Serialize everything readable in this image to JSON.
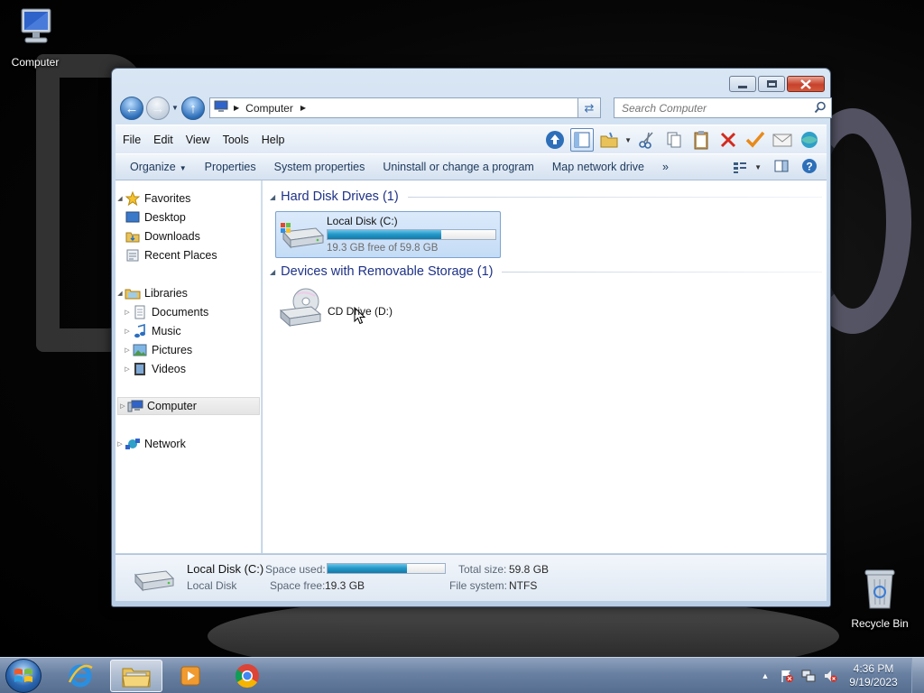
{
  "desktop": {
    "icons": [
      {
        "label": "Computer"
      },
      {
        "label": "Recycle Bin"
      }
    ]
  },
  "window": {
    "address": {
      "location": "Computer"
    },
    "search": {
      "placeholder": "Search Computer"
    },
    "menu": [
      "File",
      "Edit",
      "View",
      "Tools",
      "Help"
    ],
    "commands": {
      "organize": "Organize",
      "properties": "Properties",
      "system_properties": "System properties",
      "uninstall": "Uninstall or change a program",
      "map_drive": "Map network drive",
      "more": "»"
    },
    "nav": {
      "favorites": "Favorites",
      "desktop": "Desktop",
      "downloads": "Downloads",
      "recent": "Recent Places",
      "libraries": "Libraries",
      "documents": "Documents",
      "music": "Music",
      "pictures": "Pictures",
      "videos": "Videos",
      "computer": "Computer",
      "network": "Network"
    },
    "groups": {
      "hdd": "Hard Disk Drives (1)",
      "removable": "Devices with Removable Storage (1)"
    },
    "drives": {
      "c_name": "Local Disk (C:)",
      "c_free_text": "19.3 GB free of 59.8 GB",
      "c_used_fraction": 0.677,
      "d_name": "CD Drive (D:)"
    },
    "details": {
      "name": "Local Disk (C:)",
      "type": "Local Disk",
      "space_used_label": "Space used:",
      "space_free_label": "Space free:",
      "space_free": "19.3 GB",
      "total_size_label": "Total size:",
      "total_size": "59.8 GB",
      "file_system_label": "File system:",
      "file_system": "NTFS"
    }
  },
  "taskbar": {
    "clock_time": "4:36 PM",
    "clock_date": "9/19/2023"
  },
  "colors": {
    "accent": "#2499c9",
    "group_heading": "#1e3287",
    "command_text": "#1e395b"
  }
}
